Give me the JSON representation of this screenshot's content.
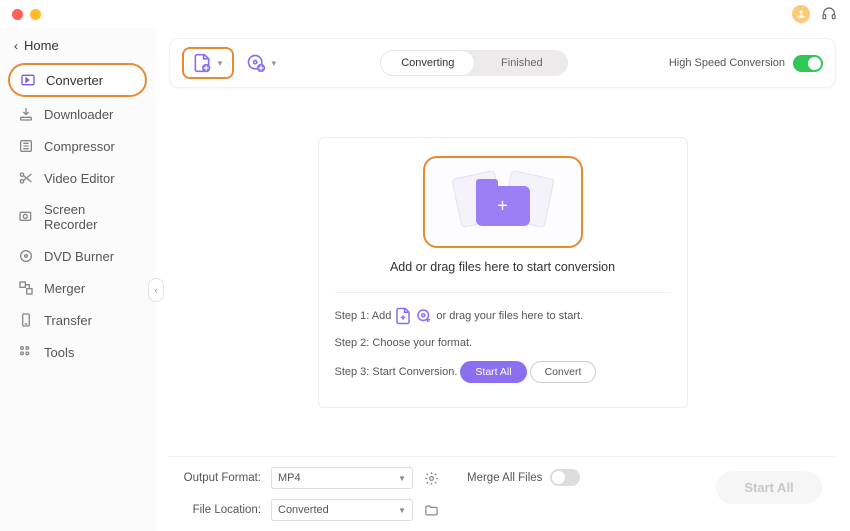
{
  "back_label": "Home",
  "nav": {
    "items": [
      {
        "label": "Converter"
      },
      {
        "label": "Downloader"
      },
      {
        "label": "Compressor"
      },
      {
        "label": "Video Editor"
      },
      {
        "label": "Screen Recorder"
      },
      {
        "label": "DVD Burner"
      },
      {
        "label": "Merger"
      },
      {
        "label": "Transfer"
      },
      {
        "label": "Tools"
      }
    ]
  },
  "tabs": {
    "converting": "Converting",
    "finished": "Finished"
  },
  "high_speed_label": "High Speed Conversion",
  "drop": {
    "text": "Add or drag files here to start conversion"
  },
  "steps": {
    "s1a": "Step 1: Add",
    "s1b": "or drag your files here to start.",
    "s2": "Step 2: Choose your format.",
    "s3": "Step 3: Start Conversion.",
    "start_all": "Start  All",
    "convert": "Convert"
  },
  "bottom": {
    "output_format_label": "Output Format:",
    "output_format_value": "MP4",
    "file_location_label": "File Location:",
    "file_location_value": "Converted",
    "merge_label": "Merge All Files",
    "start_all_button": "Start All"
  }
}
